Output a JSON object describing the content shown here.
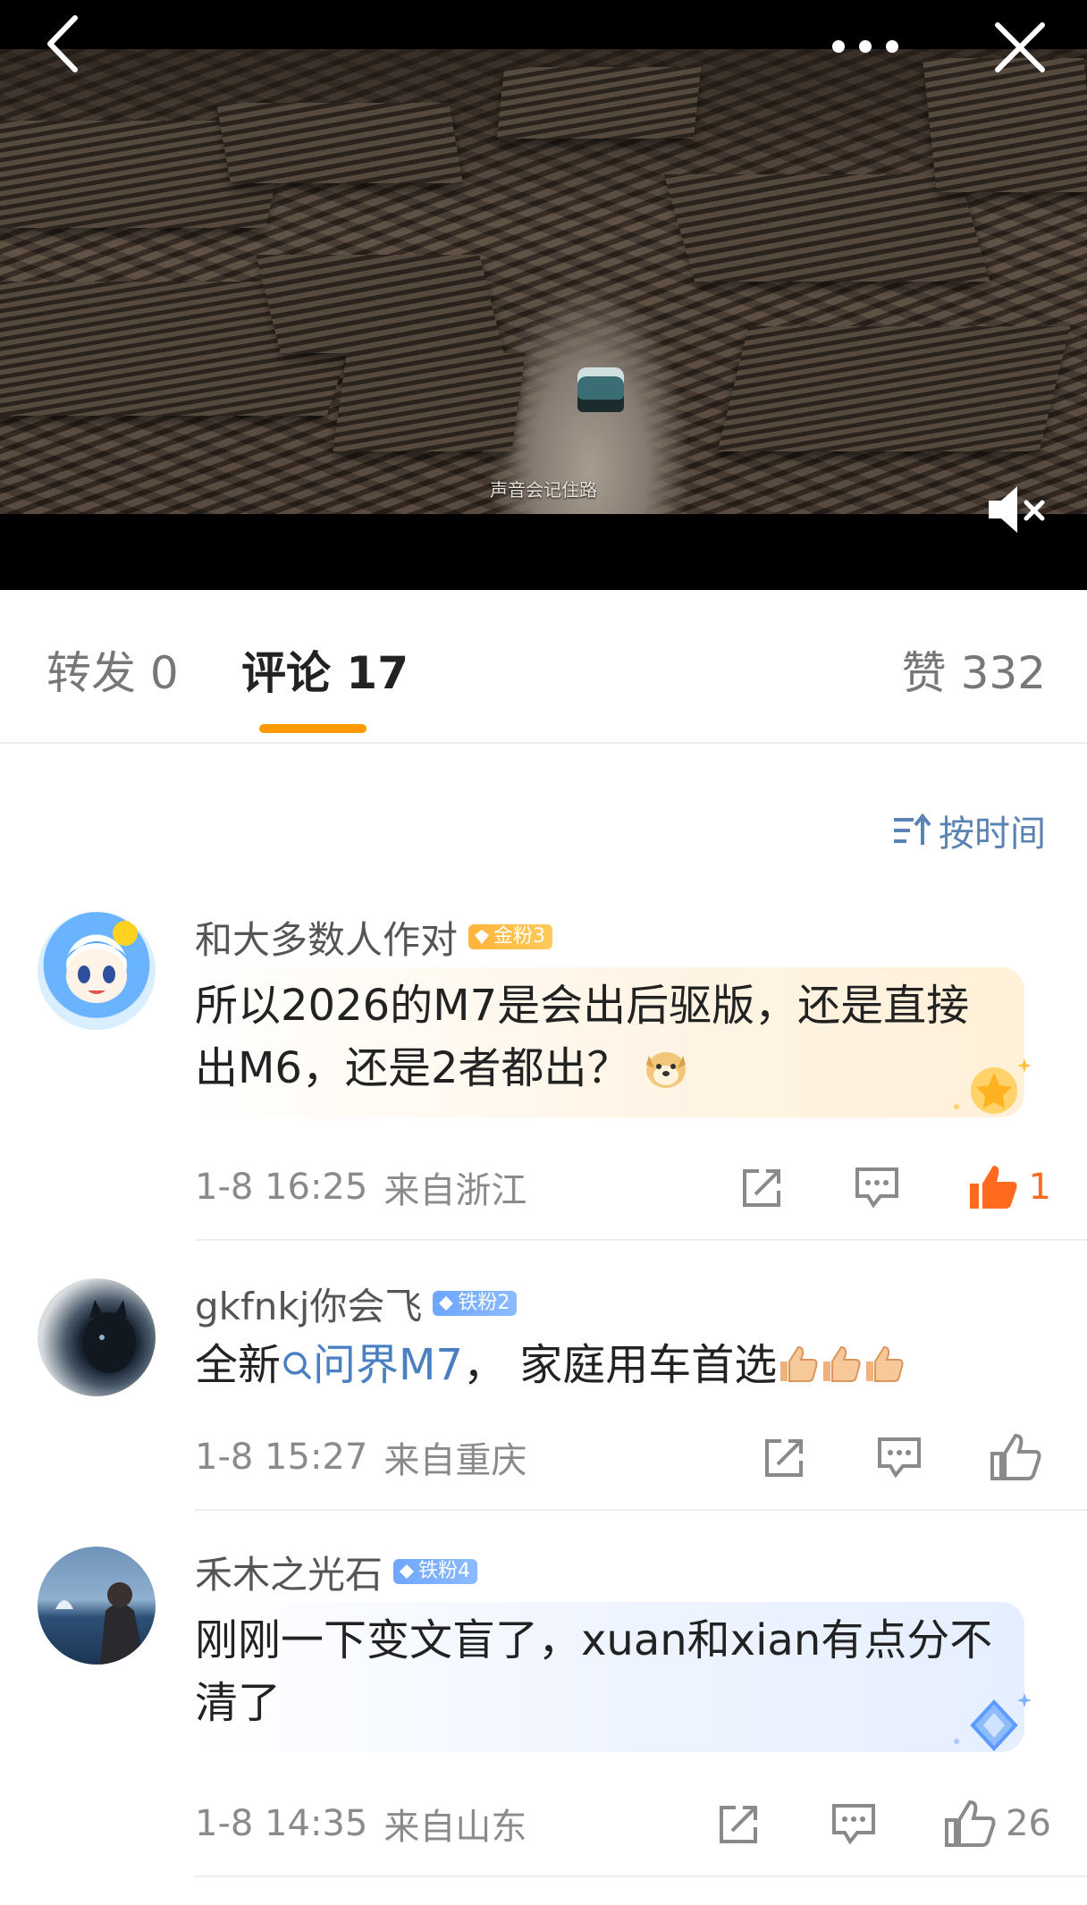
{
  "video": {
    "subtitle": "声音会记住路"
  },
  "tabs": {
    "repost": "转发 0",
    "comment": "评论 17",
    "like": "赞 332"
  },
  "sort": {
    "label": "按时间"
  },
  "comments": [
    {
      "username": "和大多数人作对",
      "badge": "金粉3",
      "text": "所以2026的M7是会出后驱版，还是直接出M6，还是2者都出？",
      "time": "1-8 16:25",
      "location": "来自浙江",
      "likes": "1"
    },
    {
      "username": "gkfnkj你会飞",
      "badge": "铁粉2",
      "text_before": "全新",
      "topic": "问界M7",
      "text_after": "，  家庭用车首选",
      "time": "1-8 15:27",
      "location": "来自重庆",
      "likes": ""
    },
    {
      "username": "禾木之光石",
      "badge": "铁粉4",
      "text": "刚刚一下变文盲了，xuan和xian有点分不清了",
      "time": "1-8 14:35",
      "location": "来自山东",
      "likes": "26"
    }
  ],
  "colors": {
    "accent": "#ff9a00",
    "like_active": "#ff6a1e",
    "link": "#4a7fc1",
    "sort": "#5a82b3"
  }
}
